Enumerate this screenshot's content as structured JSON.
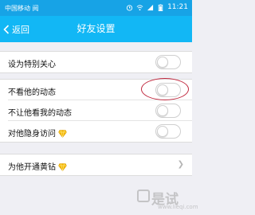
{
  "status_bar": {
    "carrier": "中国移动 阅",
    "time": "11:21",
    "icons": [
      "sim-icon",
      "alarm-icon",
      "wifi-icon",
      "signal-icon",
      "battery-icon"
    ]
  },
  "nav": {
    "back_label": "返回",
    "title": "好友设置"
  },
  "settings": [
    {
      "label": "设为特别关心",
      "control": "toggle",
      "checked": false
    },
    {
      "label": "不看他的动态",
      "control": "toggle",
      "checked": false,
      "highlighted": true
    },
    {
      "label": "不让他看我的动态",
      "control": "toggle",
      "checked": false
    },
    {
      "label": "对他隐身访问",
      "control": "toggle",
      "checked": false,
      "badge_icon": "yellow-diamond-icon"
    },
    {
      "label": "为他开通黄钻",
      "control": "chevron",
      "badge_icon": "yellow-diamond-icon"
    }
  ],
  "watermark": {
    "text": "是试",
    "sub": "www.lieqi.com"
  },
  "colors": {
    "status_bar": "#17a3e6",
    "nav_bar": "#12b7f5",
    "highlight_ellipse": "#c0283e",
    "diamond": "#f5b800"
  }
}
